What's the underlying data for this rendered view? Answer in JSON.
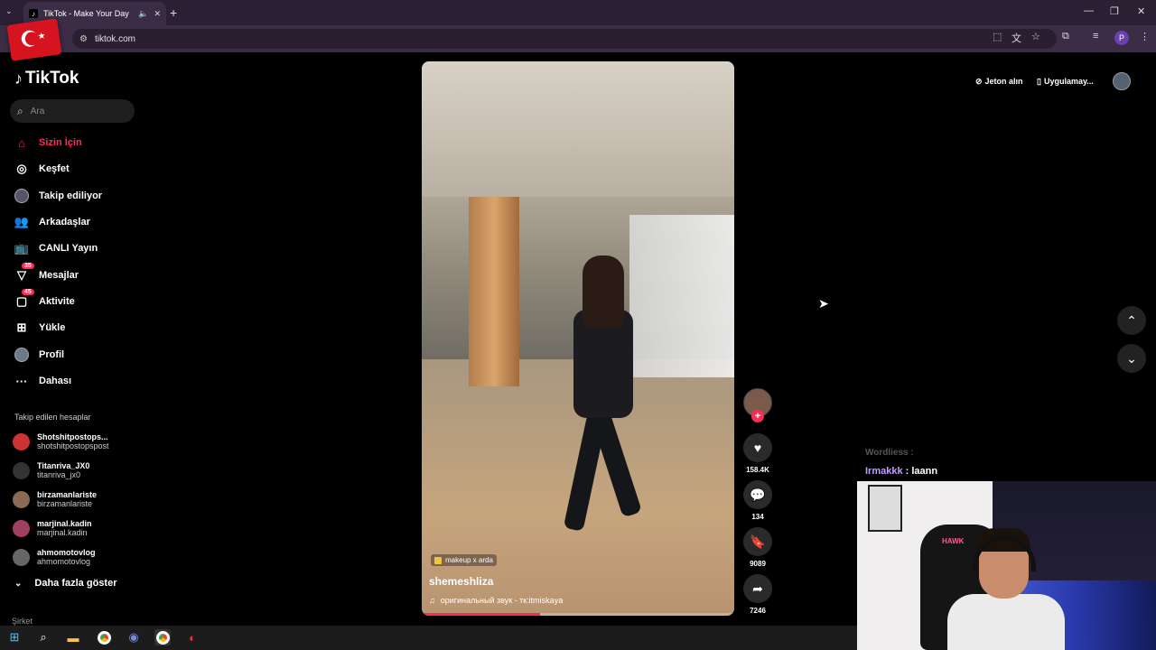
{
  "browser": {
    "tab_title": "TikTok - Make Your Day",
    "url": "tiktok.com",
    "profile_letter": "P"
  },
  "sidebar": {
    "logo": "TikTok",
    "search_placeholder": "Ara",
    "nav": [
      {
        "label": "Sizin İçin"
      },
      {
        "label": "Keşfet"
      },
      {
        "label": "Takip ediliyor"
      },
      {
        "label": "Arkadaşlar"
      },
      {
        "label": "CANLI Yayın"
      },
      {
        "label": "Mesajlar",
        "badge": "35"
      },
      {
        "label": "Aktivite",
        "badge": "45"
      },
      {
        "label": "Yükle"
      },
      {
        "label": "Profil"
      },
      {
        "label": "Dahası"
      }
    ],
    "following_header": "Takip edilen hesaplar",
    "following": [
      {
        "name": "Shotshitpostops...",
        "handle": "shotshitpostopspost"
      },
      {
        "name": "Titanriva_JX0",
        "handle": "titanriva_jx0"
      },
      {
        "name": "birzamanlariste",
        "handle": "birzamanlariste"
      },
      {
        "name": "marjinal.kadin",
        "handle": "marjinal.kadin"
      },
      {
        "name": "ahmomotovlog",
        "handle": "ahmomotovlog"
      }
    ],
    "show_more": "Daha fazla göster",
    "company": "Şirket"
  },
  "topright": {
    "coins": "Jeton alın",
    "app": "Uygulamay..."
  },
  "video": {
    "tag": "makeup x arda",
    "username": "shemeshliza",
    "sound": "оригинальный звук - тк:itmiskaya",
    "progress": 0.38
  },
  "actions": {
    "likes": "158.4K",
    "comments": "134",
    "saves": "9089",
    "shares": "7246"
  },
  "stream": {
    "chat_line1": "Wordliess :",
    "chat_user": "Irmakkk",
    "chat_msg": " : laann",
    "cam_brand": "HAWK"
  },
  "colors": {
    "accent": "#fe2c55"
  }
}
